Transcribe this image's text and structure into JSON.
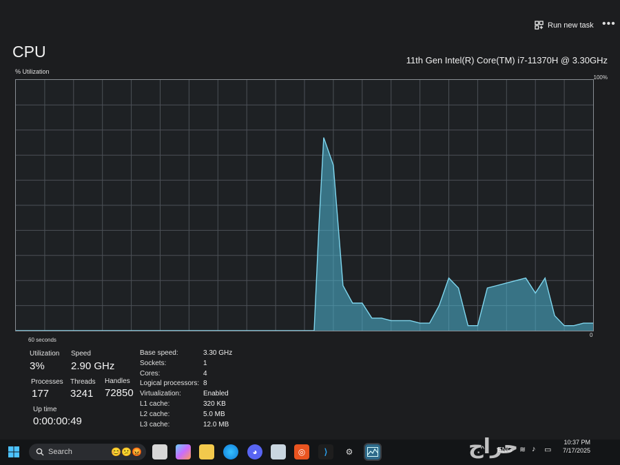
{
  "header": {
    "run_new_task": "Run new task",
    "more_menu": "•••"
  },
  "cpu": {
    "title": "CPU",
    "model": "11th Gen Intel(R) Core(TM) i7-11370H @ 3.30GHz",
    "graph_ylabel": "% Utilization",
    "graph_ymax": "100%",
    "graph_ymin": "0",
    "graph_xlabel": "60 seconds"
  },
  "chart_data": {
    "type": "area",
    "ylabel": "% Utilization",
    "xlabel": "60 seconds",
    "ylim": [
      0,
      100
    ],
    "xlim": [
      0,
      60
    ],
    "grid": true,
    "x": [
      0,
      30,
      31,
      31.5,
      32,
      33,
      34,
      35,
      36,
      37,
      38,
      39,
      40,
      41,
      42,
      43,
      44,
      45,
      46,
      47,
      48,
      49,
      50,
      51,
      52,
      53,
      54,
      55,
      56,
      57,
      58,
      59,
      60
    ],
    "values": [
      0,
      0,
      0,
      42,
      77,
      66,
      18,
      11,
      11,
      5,
      5,
      4,
      4,
      4,
      3,
      3,
      10,
      21,
      17,
      2,
      2,
      17,
      18,
      19,
      20,
      21,
      15,
      21,
      6,
      2,
      2,
      3,
      3
    ],
    "color": "#4fb8d6"
  },
  "stats": {
    "utilization_label": "Utilization",
    "utilization_value": "3%",
    "speed_label": "Speed",
    "speed_value": "2.90 GHz",
    "processes_label": "Processes",
    "processes_value": "177",
    "threads_label": "Threads",
    "threads_value": "3241",
    "handles_label": "Handles",
    "handles_value": "72850",
    "uptime_label": "Up time",
    "uptime_value": "0:00:00:49"
  },
  "specs": [
    {
      "label": "Base speed:",
      "value": "3.30 GHz"
    },
    {
      "label": "Sockets:",
      "value": "1"
    },
    {
      "label": "Cores:",
      "value": "4"
    },
    {
      "label": "Logical processors:",
      "value": "8"
    },
    {
      "label": "Virtualization:",
      "value": "Enabled"
    },
    {
      "label": "L1 cache:",
      "value": "320 KB"
    },
    {
      "label": "L2 cache:",
      "value": "5.0 MB"
    },
    {
      "label": "L3 cache:",
      "value": "12.0 MB"
    }
  ],
  "taskbar": {
    "search_label": "Search",
    "language": "ENG",
    "time": "10:37 PM",
    "date": "7/17/2025",
    "icons": [
      "windows-start-icon",
      "task-view-icon",
      "copilot-icon",
      "file-explorer-icon",
      "edge-icon",
      "discord-icon",
      "remote-desktop-icon",
      "ubuntu-icon",
      "vscode-icon",
      "obs-icon",
      "task-manager-icon"
    ]
  },
  "watermark": "حراج"
}
